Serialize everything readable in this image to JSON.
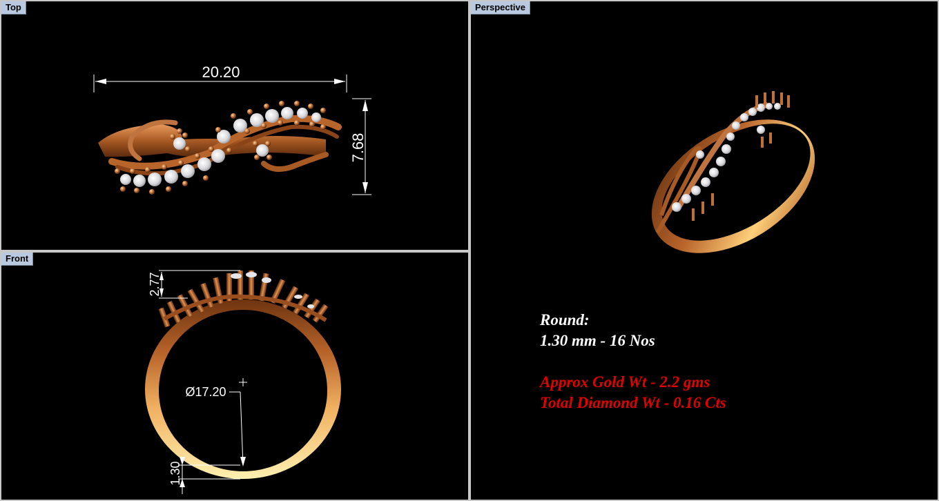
{
  "viewports": {
    "top": {
      "label": "Top"
    },
    "front": {
      "label": "Front"
    },
    "perspective": {
      "label": "Perspective"
    }
  },
  "dimensions": {
    "top_width": "20.20",
    "top_height": "7.68",
    "front_head_height": "2.77",
    "front_diameter": "Ø17.20",
    "front_shank": "1.30"
  },
  "specs": {
    "stone_shape": "Round:",
    "stone_detail": "1.30 mm - 16 Nos",
    "gold_weight": "Approx Gold Wt - 2.2 gms",
    "diamond_weight": "Total Diamond Wt - 0.16 Cts"
  },
  "colors": {
    "gold_dark": "#6e3410",
    "gold_mid": "#c0713a",
    "gold_light": "#ffd27a",
    "diamond": "#e8e8ea",
    "accent_red": "#e00000"
  }
}
